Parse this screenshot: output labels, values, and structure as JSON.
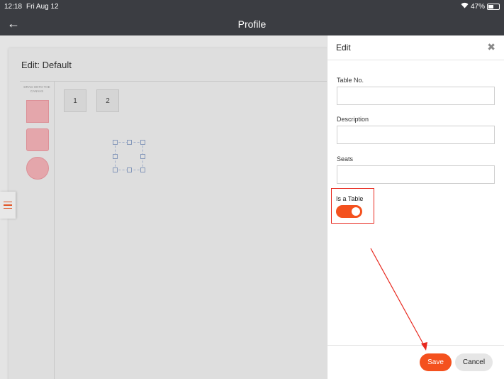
{
  "status_bar": {
    "time": "12:18",
    "date": "Fri Aug 12",
    "battery": "47%",
    "battery_level": 0.47,
    "wifi_icon": "wifi-icon"
  },
  "nav": {
    "title": "Profile",
    "back_icon": "arrow-left-icon"
  },
  "editor": {
    "heading": "Edit: Default",
    "palette_label": "DRAG ONTO THE CANVAS",
    "tables": [
      {
        "label": "1"
      },
      {
        "label": "2"
      }
    ],
    "menu_icon": "hamburger-icon"
  },
  "panel": {
    "title": "Edit",
    "close_icon": "close-icon",
    "fields": {
      "table_no": {
        "label": "Table No.",
        "value": ""
      },
      "description": {
        "label": "Description",
        "value": ""
      },
      "seats": {
        "label": "Seats",
        "value": ""
      }
    },
    "is_table": {
      "label": "Is a Table",
      "on": true
    },
    "save_label": "Save",
    "cancel_label": "Cancel"
  },
  "colors": {
    "accent": "#f4511e",
    "header": "#3b3d42",
    "highlight": "#e8281e"
  }
}
